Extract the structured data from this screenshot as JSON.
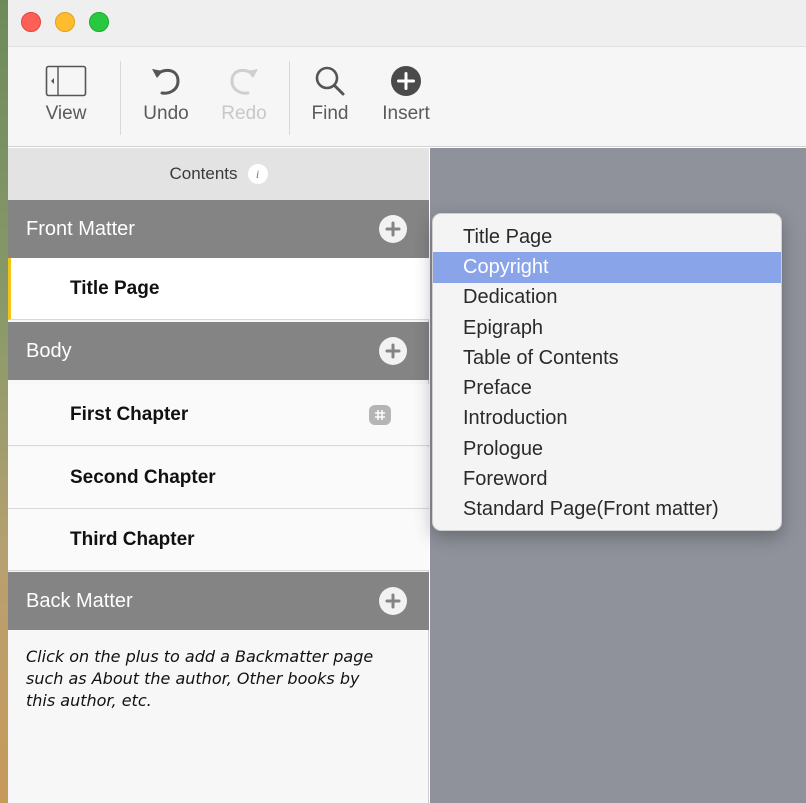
{
  "toolbar": {
    "items": [
      {
        "label": "View",
        "icon": "sidebar-toggle-icon",
        "enabled": true
      },
      {
        "label": "Undo",
        "icon": "undo-icon",
        "enabled": true
      },
      {
        "label": "Redo",
        "icon": "redo-icon",
        "enabled": false
      },
      {
        "label": "Find",
        "icon": "magnifier-icon",
        "enabled": true
      },
      {
        "label": "Insert",
        "icon": "plus-circle-icon",
        "enabled": true
      }
    ]
  },
  "sidebar": {
    "header": "Contents",
    "info_glyph": "i",
    "sections": [
      {
        "title": "Front Matter",
        "items": [
          "Title Page"
        ]
      },
      {
        "title": "Body",
        "items": [
          "First Chapter",
          "Second Chapter",
          "Third Chapter"
        ]
      },
      {
        "title": "Back Matter",
        "items": []
      }
    ],
    "back_matter_hint": "Click on the plus to add a Backmatter page such as About the author, Other books by this author, etc."
  },
  "popup_menu": {
    "items": [
      "Title Page",
      "Copyright",
      "Dedication",
      "Epigraph",
      "Table of Contents",
      "Preface",
      "Introduction",
      "Prologue",
      "Foreword",
      "Standard Page(Front matter)"
    ],
    "highlighted": "Copyright"
  },
  "colors": {
    "section_header": "#848484",
    "menu_highlight": "#8aa4ea",
    "selected_marker": "#f0c419",
    "editor_background": "#8f929b"
  }
}
